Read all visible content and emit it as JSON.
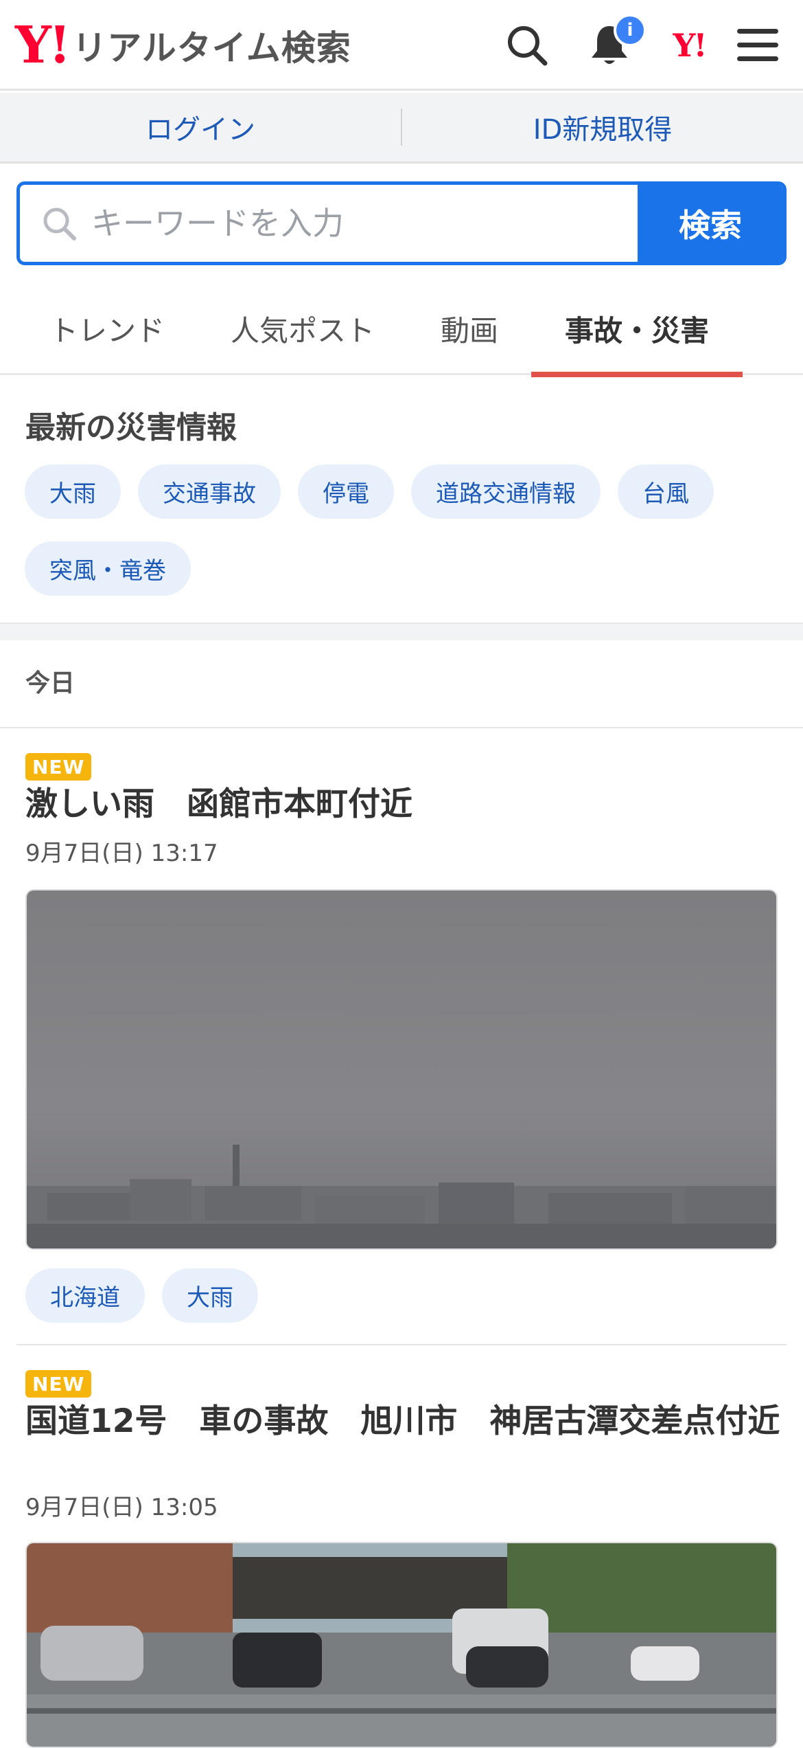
{
  "header": {
    "logo_mark": "Y!",
    "logo_text": "リアルタイム検索",
    "notification_badge": "i",
    "yahoo_mark": "Y!"
  },
  "account": {
    "login_label": "ログイン",
    "signup_label": "ID新規取得"
  },
  "search": {
    "placeholder": "キーワードを入力",
    "button_label": "検索"
  },
  "tabs": [
    {
      "label": "トレンド"
    },
    {
      "label": "人気ポスト"
    },
    {
      "label": "動画"
    },
    {
      "label": "事故・災害",
      "active": true
    }
  ],
  "disaster": {
    "title": "最新の災害情報",
    "chips": [
      "大雨",
      "交通事故",
      "停電",
      "道路交通情報",
      "台風",
      "突風・竜巻"
    ]
  },
  "section_label": "今日",
  "posts": [
    {
      "badge": "NEW",
      "title": "激しい雨　函館市本町付近",
      "date": "9月7日(日) 13:17",
      "tags": [
        "北海道",
        "大雨"
      ]
    },
    {
      "badge": "NEW",
      "title": "国道12号　車の事故　旭川市　神居古潭交差点付近",
      "date": "9月7日(日) 13:05",
      "tags": []
    }
  ],
  "colors": {
    "brand_red": "#ff0033",
    "accent_blue": "#1a73e8",
    "link_blue": "#1d5ab7",
    "active_tab_underline": "#e0524a",
    "new_badge": "#f6b50c"
  }
}
